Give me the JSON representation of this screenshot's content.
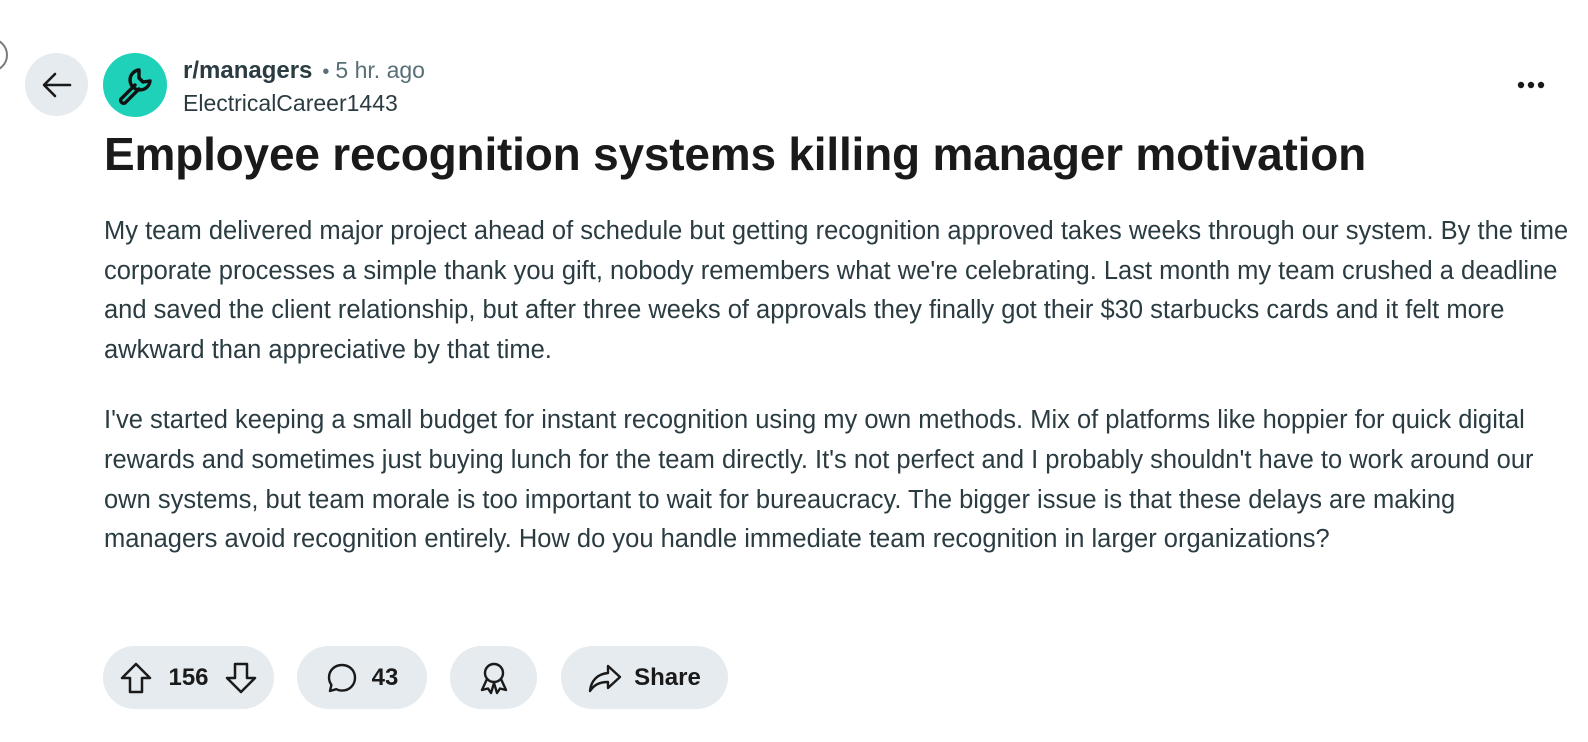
{
  "post": {
    "subreddit": "r/managers",
    "separator": "•",
    "time": "5 hr. ago",
    "author": "ElectricalCareer1443",
    "title": "Employee recognition systems killing manager motivation",
    "paragraphs": [
      "My team delivered major project ahead of schedule but getting recognition approved takes weeks through our system. By the time corporate processes a simple thank you gift, nobody remembers what we're celebrating. Last month my team crushed a deadline and saved the client relationship, but after three weeks of approvals they finally got their $30 starbucks cards and it felt more awkward than appreciative by that time.",
      "I've started keeping a small budget for instant recognition using my own methods. Mix of platforms like hoppier for quick digital rewards and sometimes just buying lunch for the team directly. It's not perfect and I probably shouldn't have to work around our own systems, but team morale is too important to wait for bureaucracy. The bigger issue is that these delays are making managers avoid recognition entirely. How do you handle immediate team recognition in larger organizations?"
    ]
  },
  "actions": {
    "score": "156",
    "comments": "43",
    "share_label": "Share"
  },
  "icons": {
    "back": "arrow-left-icon",
    "subreddit": "wrench-icon",
    "more": "ellipsis-icon",
    "upvote": "arrow-up-icon",
    "downvote": "arrow-down-icon",
    "comment": "speech-bubble-icon",
    "award": "award-ribbon-icon",
    "share": "share-arrow-icon"
  },
  "colors": {
    "avatar": "#1fd1b8",
    "pill_bg": "#e5ebee",
    "body_text": "#2a3c42",
    "meta_text": "#576f76"
  }
}
